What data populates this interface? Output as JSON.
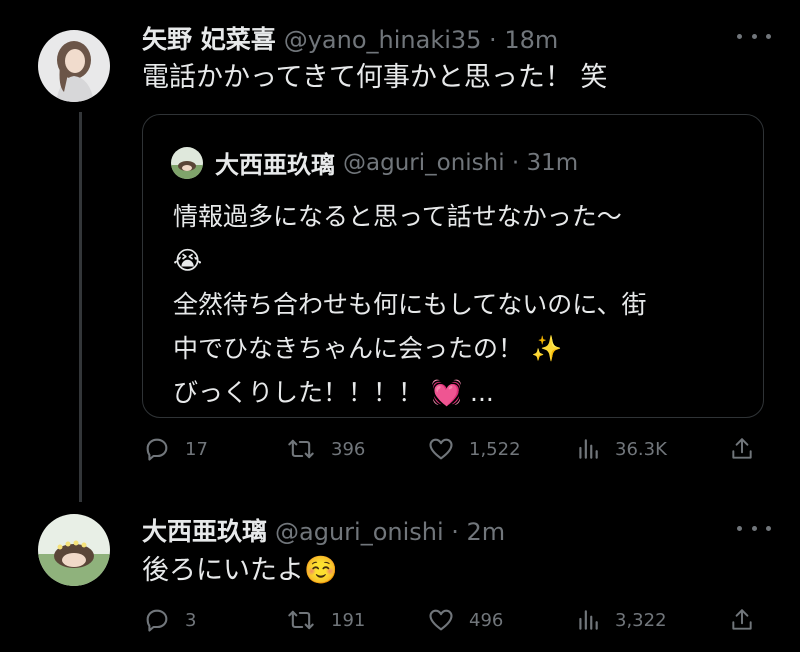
{
  "tweet1": {
    "name": "矢野 妃菜喜",
    "handle": "@yano_hinaki35 · 18m",
    "text": "電話かかってきて何事かと思った！ 笑",
    "quote": {
      "name": "大西亜玖璃",
      "handle": "@aguri_onishi · 31m",
      "lines": [
        "情報過多になると思って話せなかった〜",
        "😭",
        "全然待ち合わせも何にもしてないのに、街",
        "中でひなきちゃんに会ったの！ ✨",
        "びっくりした！！！！ 💓 ..."
      ]
    },
    "replies": "17",
    "retweets": "396",
    "likes": "1,522",
    "views": "36.3K"
  },
  "tweet2": {
    "name": "大西亜玖璃",
    "handle": "@aguri_onishi · 2m",
    "text": "後ろにいたよ☺️",
    "replies": "3",
    "retweets": "191",
    "likes": "496",
    "views": "3,322"
  },
  "icons": {
    "reply": "reply-icon",
    "retweet": "retweet-icon",
    "like": "heart-icon",
    "views": "views-icon",
    "share": "share-icon",
    "more": "more-icon"
  },
  "colors": {
    "background": "#000000",
    "text": "#e7e9ea",
    "muted": "#71767b",
    "border": "#2f3336"
  }
}
